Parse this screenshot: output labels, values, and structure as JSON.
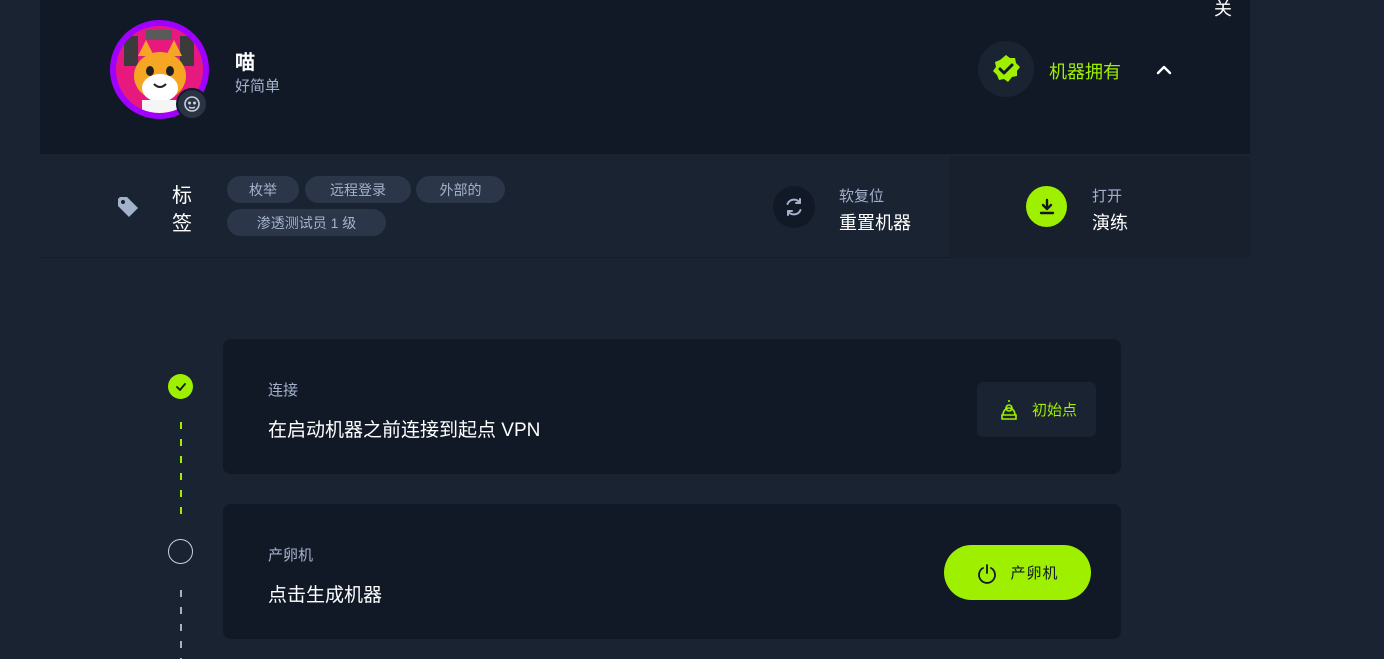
{
  "corner": {
    "text": "关"
  },
  "profile": {
    "name": "喵",
    "subtitle": "好简单"
  },
  "owned": {
    "label": "机器拥有",
    "icon": "verified-check-icon"
  },
  "tags": {
    "title_line1": "标",
    "title_line2": "签",
    "items": [
      "枚举",
      "远程登录",
      "外部的",
      "渗透测试员 1 级"
    ]
  },
  "reset": {
    "subtitle": "软复位",
    "label": "重置机器"
  },
  "walkthrough": {
    "subtitle": "打开",
    "label": "演练"
  },
  "steps": [
    {
      "subtitle": "连接",
      "text": "在启动机器之前连接到起点 VPN",
      "button": "初始点",
      "done": true
    },
    {
      "subtitle": "产卵机",
      "text": "点击生成机器",
      "button": "产卵机",
      "done": false
    }
  ],
  "colors": {
    "accent": "#9fef00",
    "bg": "#1a2332",
    "card": "#111927",
    "muted": "#a4b1cd",
    "avatar_ring": "#9f00ff"
  }
}
